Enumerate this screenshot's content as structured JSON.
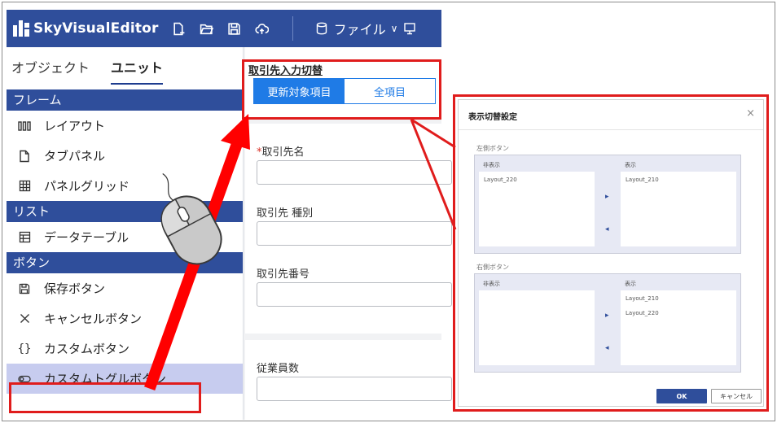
{
  "topbar": {
    "brand": "SkyVisualEditor",
    "menu_file": "ファイル"
  },
  "sidebar": {
    "tabs": [
      {
        "label": "オブジェクト"
      },
      {
        "label": "ユニット"
      }
    ],
    "categories": [
      {
        "label": "フレーム",
        "items": [
          {
            "label": "レイアウト",
            "icon": "columns-icon"
          },
          {
            "label": "タブパネル",
            "icon": "document-icon"
          },
          {
            "label": "パネルグリッド",
            "icon": "grid-icon"
          }
        ]
      },
      {
        "label": "リスト",
        "items": [
          {
            "label": "データテーブル",
            "icon": "table-icon"
          }
        ]
      },
      {
        "label": "ボタン",
        "items": [
          {
            "label": "保存ボタン",
            "icon": "floppy-icon"
          },
          {
            "label": "キャンセルボタン",
            "icon": "close-icon"
          },
          {
            "label": "カスタムボタン",
            "icon": "braces-icon"
          },
          {
            "label": "カスタムトグルボタン",
            "icon": "toggle-icon"
          }
        ]
      }
    ]
  },
  "form": {
    "switch_label": "取引先入力切替",
    "switch_on": "更新対象項目",
    "switch_off": "全項目",
    "required_mark": "*",
    "field1": "取引先名",
    "field2": "取引先 種別",
    "field3": "取引先番号",
    "field4": "従業員数"
  },
  "dialog": {
    "title": "表示切替設定",
    "close": "×",
    "left_group": "左側ボタン",
    "right_group": "右側ボタン",
    "hidden": "非表示",
    "shown": "表示",
    "left_hidden_items": [
      "Layout_220"
    ],
    "left_shown_items": [
      "Layout_210"
    ],
    "right_shown_items": [
      "Layout_210",
      "Layout_220"
    ],
    "arrow_right": "▸",
    "arrow_left": "◂",
    "ok": "OK",
    "cancel": "キャンセル"
  },
  "colors": {
    "primary": "#2f4e9b",
    "accent_blue": "#1f7be6",
    "highlight_red": "#e01c1c",
    "selected_bg": "#c7ccef"
  }
}
